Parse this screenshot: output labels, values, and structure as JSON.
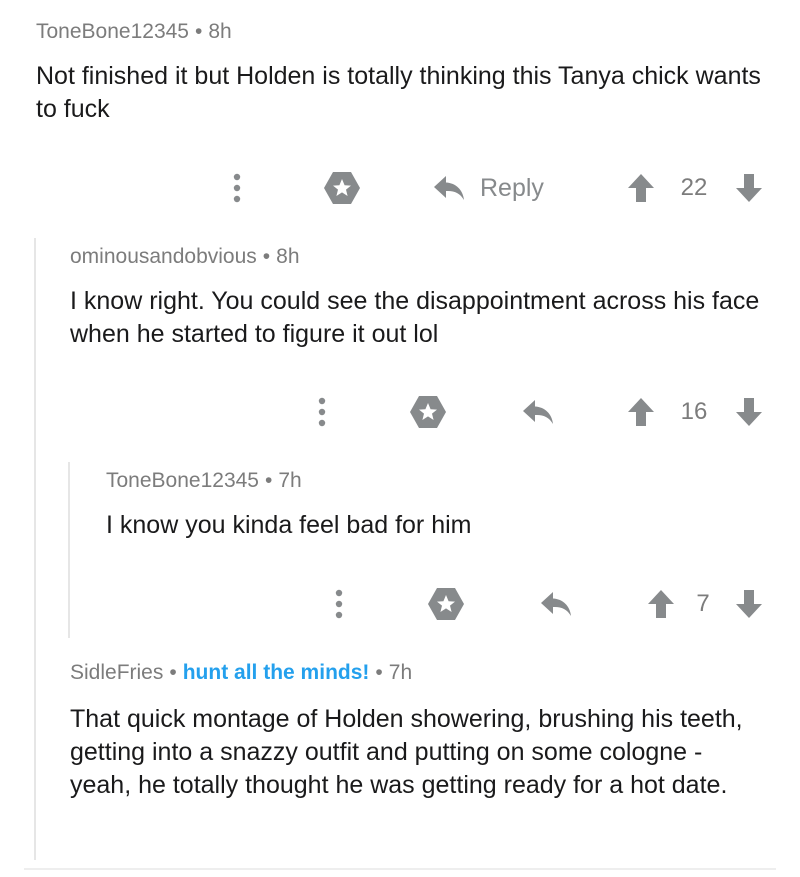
{
  "comments": [
    {
      "author": "ToneBone12345",
      "age": "8h",
      "text": "Not finished it but Holden is totally thinking this Tanya chick wants to fuck",
      "reply_label": "Reply",
      "score": "22"
    },
    {
      "author": "ominousandobvious",
      "age": "8h",
      "text": "I know right. You could see the disappointment across his face when he started to figure it out lol",
      "score": "16"
    },
    {
      "author": "ToneBone12345",
      "age": "7h",
      "text": "I know you kinda feel bad for him",
      "score": "7"
    },
    {
      "author": "SidleFries",
      "flair": "hunt all the minds!",
      "age": "7h",
      "text": "That quick montage of Holden showering, brushing his teeth, getting into a snazzy outfit and putting on some cologne - yeah, he totally thought he was getting ready for a hot date."
    }
  ],
  "separator": "•",
  "colors": {
    "meta": "#7c7c7c",
    "flair": "#24a0ed",
    "icon": "#878a8c",
    "thread_line": "#e6e6e6"
  },
  "icons": [
    "more-options-icon",
    "award-icon",
    "reply-arrow-icon",
    "upvote-icon",
    "downvote-icon"
  ]
}
